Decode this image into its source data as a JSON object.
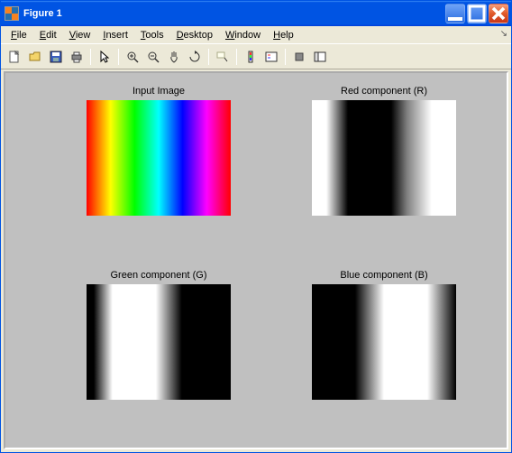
{
  "window": {
    "title": "Figure 1"
  },
  "menu": {
    "file": "File",
    "edit": "Edit",
    "view": "View",
    "insert": "Insert",
    "tools": "Tools",
    "desktop": "Desktop",
    "window": "Window",
    "help": "Help"
  },
  "subplots": {
    "input": "Input Image",
    "r": "Red component (R)",
    "g": "Green component (G)",
    "b": "Blue component (B)"
  },
  "chart_data": [
    {
      "type": "heatmap",
      "title": "Input Image",
      "description": "HSV hue sweep 0 to 1 across x, full saturation and value",
      "x": [
        0,
        1,
        2,
        3,
        4,
        5,
        6
      ],
      "colors": [
        "#ff0000",
        "#ffff00",
        "#00ff00",
        "#00ffff",
        "#0000ff",
        "#ff00ff",
        "#ff0000"
      ]
    },
    {
      "type": "line",
      "title": "Red component (R)",
      "x": [
        0,
        0.17,
        0.33,
        0.5,
        0.67,
        0.83,
        1.0
      ],
      "values": [
        1,
        1,
        0,
        0,
        0,
        1,
        1
      ],
      "ylim": [
        0,
        1
      ]
    },
    {
      "type": "line",
      "title": "Green component (G)",
      "x": [
        0,
        0.17,
        0.33,
        0.5,
        0.67,
        0.83,
        1.0
      ],
      "values": [
        0,
        1,
        1,
        1,
        0,
        0,
        0
      ],
      "ylim": [
        0,
        1
      ]
    },
    {
      "type": "line",
      "title": "Blue component (B)",
      "x": [
        0,
        0.17,
        0.33,
        0.5,
        0.67,
        0.83,
        1.0
      ],
      "values": [
        0,
        0,
        0,
        1,
        1,
        1,
        0
      ],
      "ylim": [
        0,
        1
      ]
    }
  ]
}
